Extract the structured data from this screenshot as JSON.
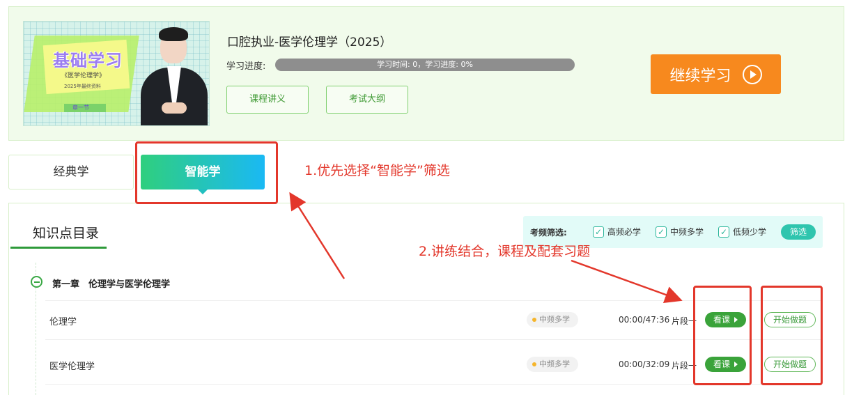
{
  "course": {
    "cover": {
      "title": "基础学习",
      "subtitle": "《医学伦理学》",
      "tagline": "2025年最终资料",
      "tag": "章一节"
    },
    "title": "口腔执业-医学伦理学（2025）",
    "progress_label": "学习进度:",
    "progress_text": "学习时间: 0，学习进度: 0%",
    "progress_percent": 0,
    "handout_button": "课程讲义",
    "syllabus_button": "考试大纲",
    "continue_button": "继续学习"
  },
  "tabs": [
    {
      "label": "经典学",
      "active": false
    },
    {
      "label": "智能学",
      "active": true
    }
  ],
  "catalog": {
    "title": "知识点目录",
    "filter": {
      "label": "考频筛选:",
      "options": [
        {
          "label": "高频必学",
          "checked": true
        },
        {
          "label": "中频多学",
          "checked": true
        },
        {
          "label": "低频少学",
          "checked": true
        }
      ],
      "button": "筛选"
    },
    "chapter": {
      "title": "第一章　伦理学与医学伦理学",
      "lessons": [
        {
          "name": "伦理学",
          "frequency": "中频多学",
          "time": "00:00/47:36",
          "segment": "片段一",
          "watch": "看课",
          "practice": "开始做题"
        },
        {
          "name": "医学伦理学",
          "frequency": "中频多学",
          "time": "00:00/32:09",
          "segment": "片段一",
          "watch": "看课",
          "practice": "开始做题"
        }
      ]
    }
  },
  "annotations": {
    "note1": "1.优先选择“智能学”筛选",
    "note2": "2.讲练结合，课程及配套习题"
  },
  "colors": {
    "accent_green": "#3aa33a",
    "continue_orange": "#f7891e",
    "annotation_red": "#e3372b",
    "smart_tab_gradient": [
      "#2fcf7e",
      "#1ab9f4"
    ]
  }
}
